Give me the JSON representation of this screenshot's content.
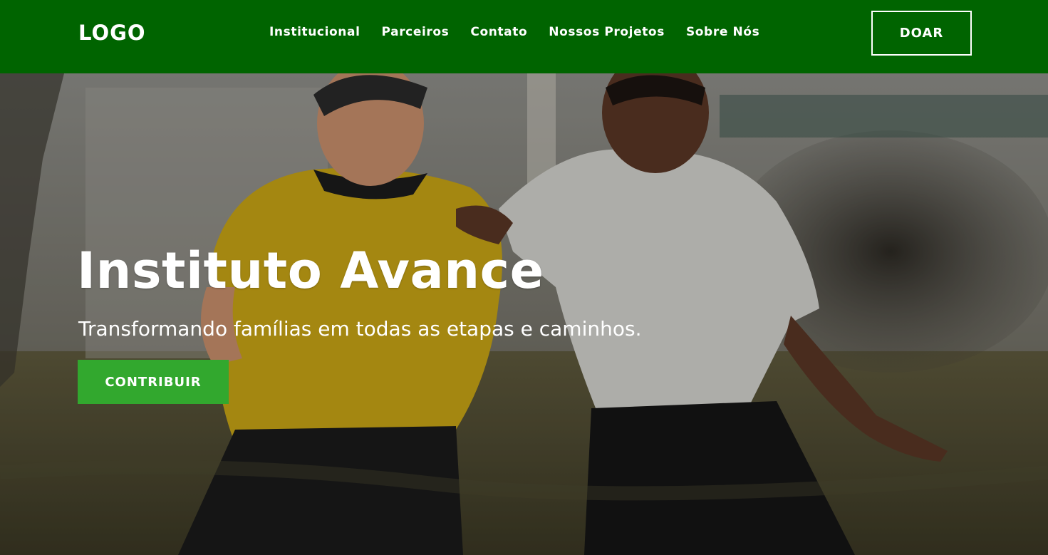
{
  "header": {
    "logo": "LOGO",
    "nav": [
      {
        "label": "Institucional"
      },
      {
        "label": "Parceiros"
      },
      {
        "label": "Contato"
      },
      {
        "label": "Nossos Projetos"
      },
      {
        "label": "Sobre Nós"
      }
    ],
    "donate_label": "DOAR"
  },
  "hero": {
    "title": "Instituto Avance",
    "subtitle": "Transformando famílias em todas as etapas e caminhos.",
    "cta_label": "CONTRIBUIR"
  },
  "colors": {
    "header_bg": "#006400",
    "cta_bg": "#32a82e",
    "text": "#ffffff"
  }
}
